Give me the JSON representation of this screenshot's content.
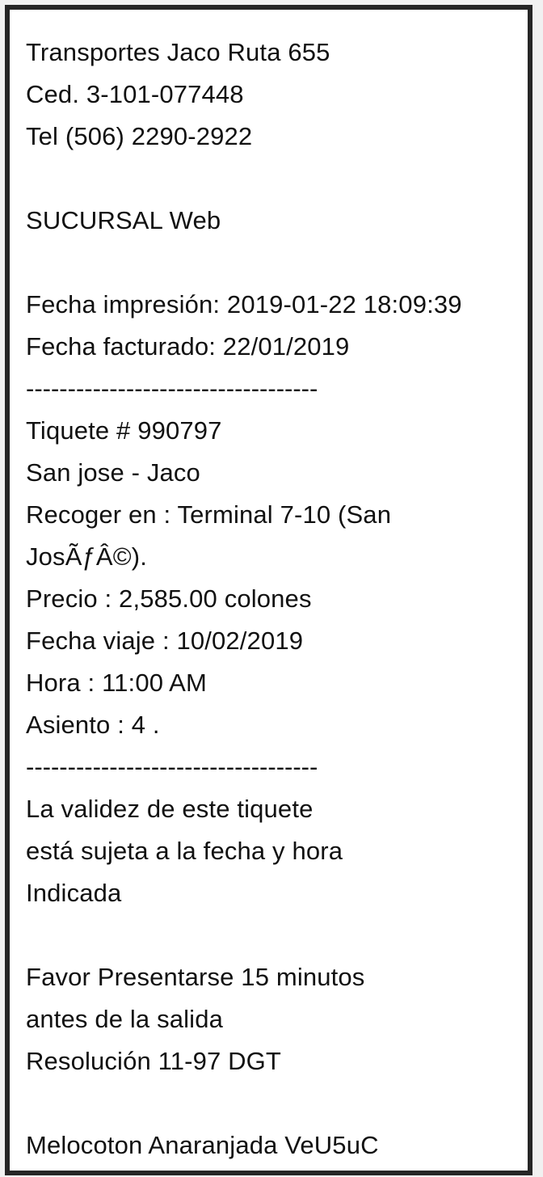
{
  "header": {
    "company": "Transportes Jaco Ruta 655",
    "cedula": "Ced. 3-101-077448",
    "phone": "Tel (506) 2290-2922"
  },
  "branch": "SUCURSAL Web",
  "dates": {
    "print_date": "Fecha impresión: 2019-01-22 18:09:39",
    "billed_date": "Fecha facturado: 22/01/2019"
  },
  "divider": "-----------------------------------",
  "ticket": {
    "number": "Tiquete # 990797",
    "route": "San jose - Jaco",
    "pickup_line1": "Recoger en : Terminal 7-10 (San",
    "pickup_line2": "JosÃƒÂ©).",
    "price": "Precio : 2,585.00 colones",
    "travel_date": "Fecha viaje : 10/02/2019",
    "time": "Hora : 11:00 AM",
    "seat": "Asiento : 4 ."
  },
  "notes": {
    "validity_line1": "La validez de este tiquete",
    "validity_line2": "está sujeta a la fecha y hora",
    "validity_line3": "Indicada",
    "arrive_line1": "Favor Presentarse 15 minutos",
    "arrive_line2": "antes de la salida",
    "resolution": "Resolución 11-97 DGT"
  },
  "code": "Melocoton Anaranjada VeU5uC"
}
